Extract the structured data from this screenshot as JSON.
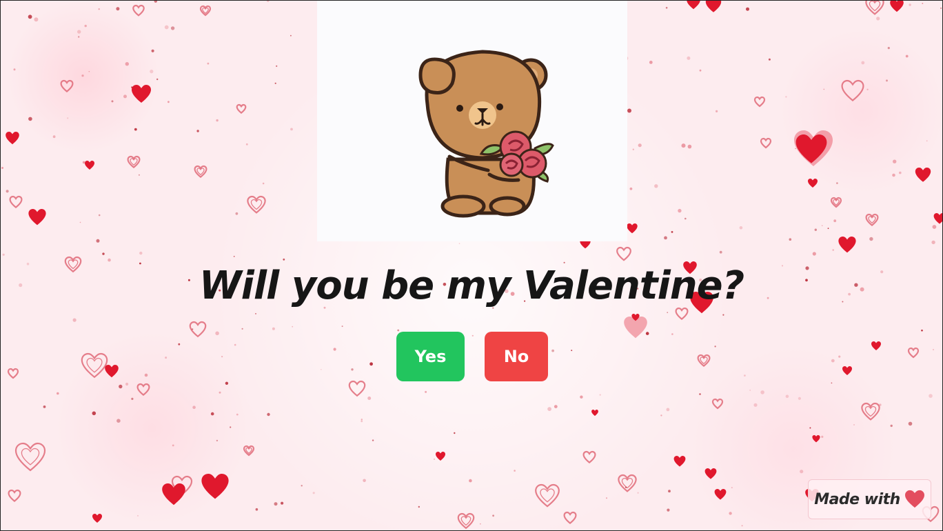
{
  "page": {
    "question": "Will you be my Valentine?"
  },
  "buttons": {
    "yes_label": "Yes",
    "no_label": "No"
  },
  "badge": {
    "label": "Made with",
    "icon": "heart-icon"
  },
  "hero": {
    "image": "teddy-bear-holding-roses"
  },
  "colors": {
    "yes_button": "#22c55e",
    "no_button": "#ef4444",
    "heart_red": "#e0182d",
    "background": "#fdecef",
    "text": "#161616"
  }
}
